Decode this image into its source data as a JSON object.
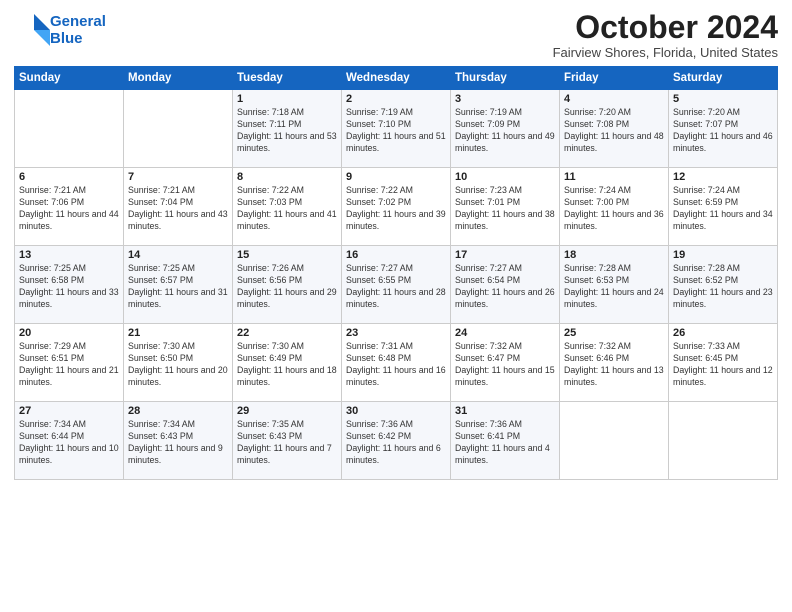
{
  "header": {
    "logo_line1": "General",
    "logo_line2": "Blue",
    "month": "October 2024",
    "location": "Fairview Shores, Florida, United States"
  },
  "weekdays": [
    "Sunday",
    "Monday",
    "Tuesday",
    "Wednesday",
    "Thursday",
    "Friday",
    "Saturday"
  ],
  "weeks": [
    [
      {
        "day": "",
        "info": ""
      },
      {
        "day": "",
        "info": ""
      },
      {
        "day": "1",
        "info": "Sunrise: 7:18 AM\nSunset: 7:11 PM\nDaylight: 11 hours and 53 minutes."
      },
      {
        "day": "2",
        "info": "Sunrise: 7:19 AM\nSunset: 7:10 PM\nDaylight: 11 hours and 51 minutes."
      },
      {
        "day": "3",
        "info": "Sunrise: 7:19 AM\nSunset: 7:09 PM\nDaylight: 11 hours and 49 minutes."
      },
      {
        "day": "4",
        "info": "Sunrise: 7:20 AM\nSunset: 7:08 PM\nDaylight: 11 hours and 48 minutes."
      },
      {
        "day": "5",
        "info": "Sunrise: 7:20 AM\nSunset: 7:07 PM\nDaylight: 11 hours and 46 minutes."
      }
    ],
    [
      {
        "day": "6",
        "info": "Sunrise: 7:21 AM\nSunset: 7:06 PM\nDaylight: 11 hours and 44 minutes."
      },
      {
        "day": "7",
        "info": "Sunrise: 7:21 AM\nSunset: 7:04 PM\nDaylight: 11 hours and 43 minutes."
      },
      {
        "day": "8",
        "info": "Sunrise: 7:22 AM\nSunset: 7:03 PM\nDaylight: 11 hours and 41 minutes."
      },
      {
        "day": "9",
        "info": "Sunrise: 7:22 AM\nSunset: 7:02 PM\nDaylight: 11 hours and 39 minutes."
      },
      {
        "day": "10",
        "info": "Sunrise: 7:23 AM\nSunset: 7:01 PM\nDaylight: 11 hours and 38 minutes."
      },
      {
        "day": "11",
        "info": "Sunrise: 7:24 AM\nSunset: 7:00 PM\nDaylight: 11 hours and 36 minutes."
      },
      {
        "day": "12",
        "info": "Sunrise: 7:24 AM\nSunset: 6:59 PM\nDaylight: 11 hours and 34 minutes."
      }
    ],
    [
      {
        "day": "13",
        "info": "Sunrise: 7:25 AM\nSunset: 6:58 PM\nDaylight: 11 hours and 33 minutes."
      },
      {
        "day": "14",
        "info": "Sunrise: 7:25 AM\nSunset: 6:57 PM\nDaylight: 11 hours and 31 minutes."
      },
      {
        "day": "15",
        "info": "Sunrise: 7:26 AM\nSunset: 6:56 PM\nDaylight: 11 hours and 29 minutes."
      },
      {
        "day": "16",
        "info": "Sunrise: 7:27 AM\nSunset: 6:55 PM\nDaylight: 11 hours and 28 minutes."
      },
      {
        "day": "17",
        "info": "Sunrise: 7:27 AM\nSunset: 6:54 PM\nDaylight: 11 hours and 26 minutes."
      },
      {
        "day": "18",
        "info": "Sunrise: 7:28 AM\nSunset: 6:53 PM\nDaylight: 11 hours and 24 minutes."
      },
      {
        "day": "19",
        "info": "Sunrise: 7:28 AM\nSunset: 6:52 PM\nDaylight: 11 hours and 23 minutes."
      }
    ],
    [
      {
        "day": "20",
        "info": "Sunrise: 7:29 AM\nSunset: 6:51 PM\nDaylight: 11 hours and 21 minutes."
      },
      {
        "day": "21",
        "info": "Sunrise: 7:30 AM\nSunset: 6:50 PM\nDaylight: 11 hours and 20 minutes."
      },
      {
        "day": "22",
        "info": "Sunrise: 7:30 AM\nSunset: 6:49 PM\nDaylight: 11 hours and 18 minutes."
      },
      {
        "day": "23",
        "info": "Sunrise: 7:31 AM\nSunset: 6:48 PM\nDaylight: 11 hours and 16 minutes."
      },
      {
        "day": "24",
        "info": "Sunrise: 7:32 AM\nSunset: 6:47 PM\nDaylight: 11 hours and 15 minutes."
      },
      {
        "day": "25",
        "info": "Sunrise: 7:32 AM\nSunset: 6:46 PM\nDaylight: 11 hours and 13 minutes."
      },
      {
        "day": "26",
        "info": "Sunrise: 7:33 AM\nSunset: 6:45 PM\nDaylight: 11 hours and 12 minutes."
      }
    ],
    [
      {
        "day": "27",
        "info": "Sunrise: 7:34 AM\nSunset: 6:44 PM\nDaylight: 11 hours and 10 minutes."
      },
      {
        "day": "28",
        "info": "Sunrise: 7:34 AM\nSunset: 6:43 PM\nDaylight: 11 hours and 9 minutes."
      },
      {
        "day": "29",
        "info": "Sunrise: 7:35 AM\nSunset: 6:43 PM\nDaylight: 11 hours and 7 minutes."
      },
      {
        "day": "30",
        "info": "Sunrise: 7:36 AM\nSunset: 6:42 PM\nDaylight: 11 hours and 6 minutes."
      },
      {
        "day": "31",
        "info": "Sunrise: 7:36 AM\nSunset: 6:41 PM\nDaylight: 11 hours and 4 minutes."
      },
      {
        "day": "",
        "info": ""
      },
      {
        "day": "",
        "info": ""
      }
    ]
  ]
}
